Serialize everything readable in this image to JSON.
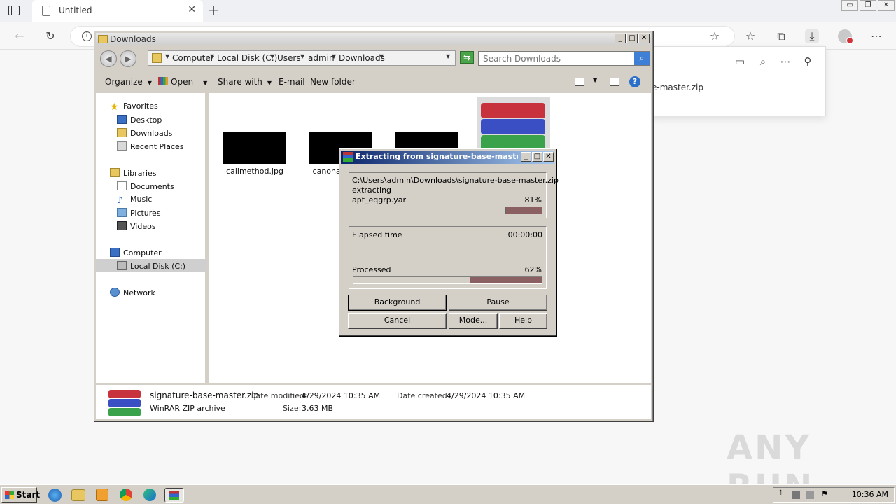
{
  "browser": {
    "tab_title": "Untitled",
    "tab_close": "✕",
    "new_tab": "+",
    "downloads_flyout": {
      "file_name_partial": "e-master.zip"
    }
  },
  "explorer": {
    "title": "Downloads",
    "breadcrumbs": [
      "Computer",
      "Local Disk (C:)",
      "Users",
      "admin",
      "Downloads"
    ],
    "search_placeholder": "Search Downloads",
    "toolbar": {
      "organize": "Organize",
      "open": "Open",
      "share_with": "Share with",
      "email": "E-mail",
      "new_folder": "New folder"
    },
    "nav": {
      "favorites": "Favorites",
      "desktop": "Desktop",
      "downloads": "Downloads",
      "recent_places": "Recent Places",
      "libraries": "Libraries",
      "documents": "Documents",
      "music": "Music",
      "pictures": "Pictures",
      "videos": "Videos",
      "computer": "Computer",
      "local_disk": "Local Disk (C:)",
      "network": "Network"
    },
    "files": [
      {
        "name": "callmethod.jpg"
      },
      {
        "name": "canonam"
      }
    ],
    "details": {
      "file_name": "signature-base-master.zip",
      "date_modified_label": "Date modified:",
      "date_modified": "4/29/2024 10:35 AM",
      "date_created_label": "Date created:",
      "date_created": "4/29/2024 10:35 AM",
      "type": "WinRAR ZIP archive",
      "size_label": "Size:",
      "size": "3.63 MB"
    }
  },
  "winrar_dialog": {
    "title": "Extracting from signature-base-maste...",
    "archive_path": "C:\\Users\\admin\\Downloads\\signature-base-master.zip",
    "action": "extracting",
    "current_file": "apt_eqgrp.yar",
    "current_percent": "81%",
    "current_fraction": 0.81,
    "elapsed_label": "Elapsed time",
    "elapsed_value": "00:00:00",
    "processed_label": "Processed",
    "processed_percent": "62%",
    "processed_fraction": 0.62,
    "buttons": {
      "background": "Background",
      "pause": "Pause",
      "cancel": "Cancel",
      "mode": "Mode...",
      "help": "Help"
    }
  },
  "watermark": "ANY RUN",
  "taskbar": {
    "start": "Start",
    "clock": "10:36 AM"
  }
}
